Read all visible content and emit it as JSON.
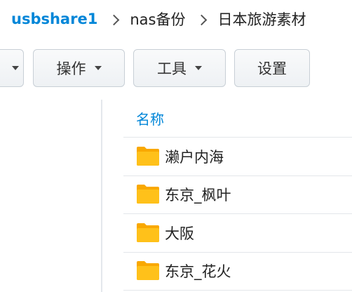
{
  "breadcrumb": {
    "items": [
      "usbshare1",
      "nas备份",
      "日本旅游素材"
    ]
  },
  "toolbar": {
    "action_label": "操作",
    "tools_label": "工具",
    "settings_label": "设置"
  },
  "file_list": {
    "column_name": "名称",
    "rows": [
      {
        "name": "濑户内海",
        "icon": "folder-icon"
      },
      {
        "name": "东京_枫叶",
        "icon": "folder-icon"
      },
      {
        "name": "大阪",
        "icon": "folder-icon"
      },
      {
        "name": "东京_花火",
        "icon": "folder-icon"
      }
    ]
  },
  "colors": {
    "accent": "#0086d8",
    "folder": "#f9a800"
  }
}
